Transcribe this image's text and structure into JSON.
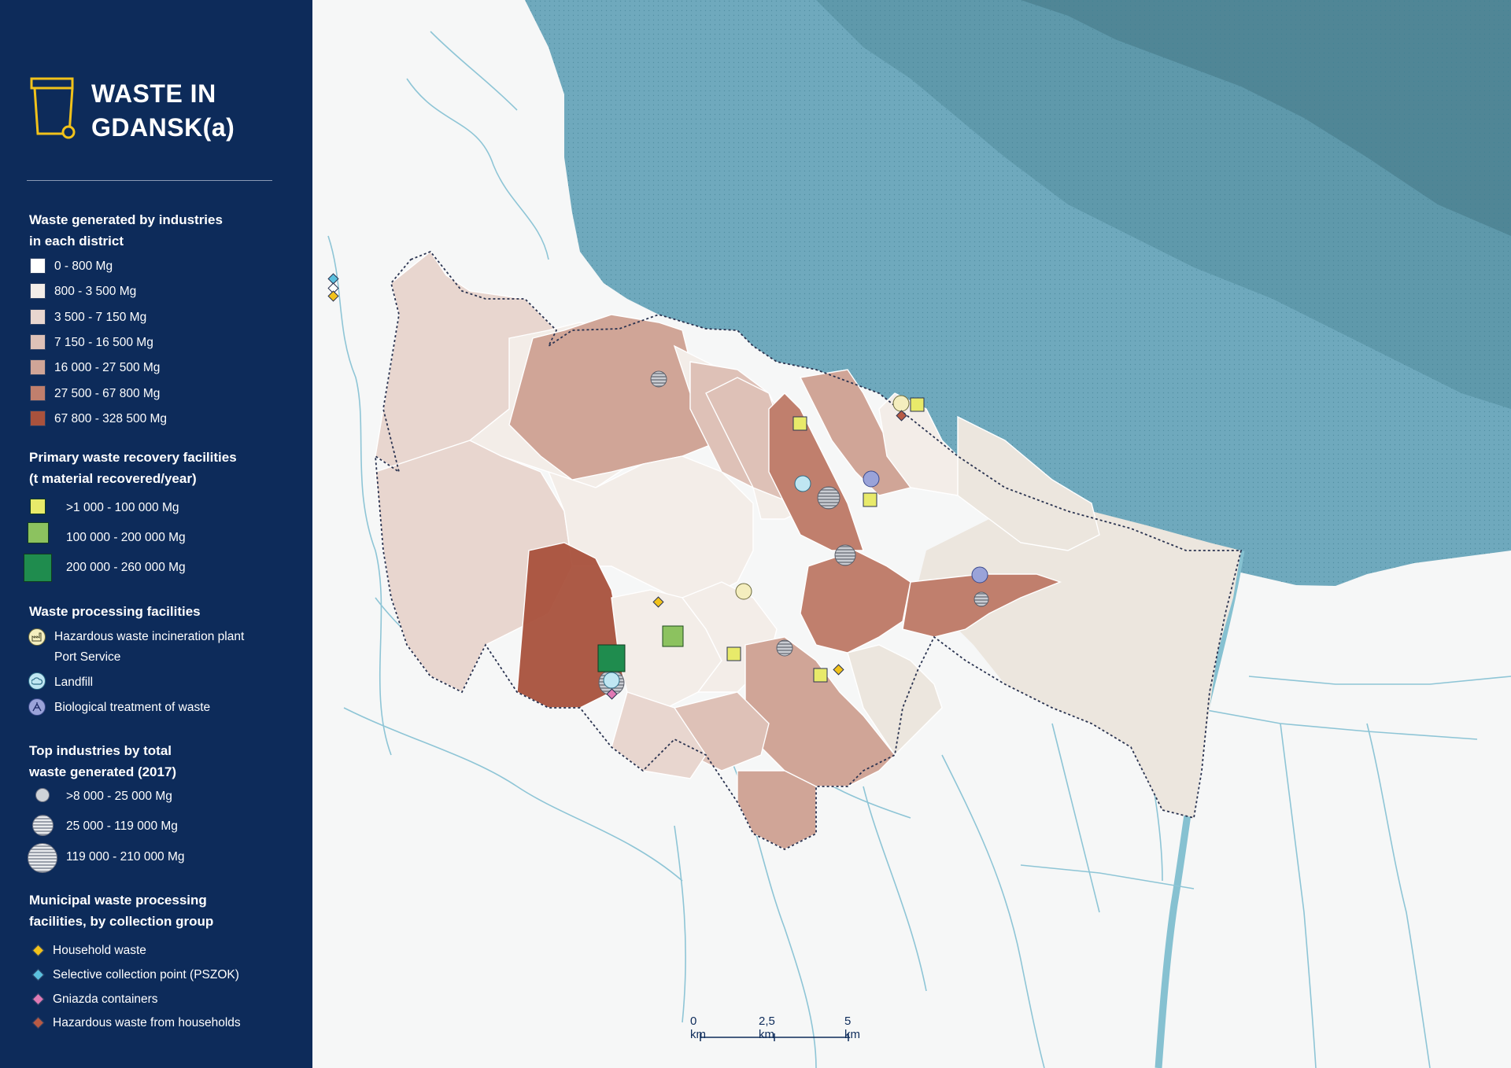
{
  "title": "WASTE IN GDANSK(a)",
  "colors": {
    "sidebar_bg": "#0d2b5a",
    "sea": "#5fa3b8",
    "sea_deep": "#4f7f8c",
    "land": "#f6f7f7",
    "rivers": "#8ec5d6",
    "boundary": "#2a3350"
  },
  "legend_industry": {
    "title_line1": "Waste generated by industries",
    "title_line2": "in each district",
    "classes": [
      {
        "label": "0 - 800 Mg",
        "color": "#ffffff"
      },
      {
        "label": "800 - 3 500 Mg",
        "color": "#f3ede8"
      },
      {
        "label": "3 500 - 7 150 Mg",
        "color": "#e8d6cf"
      },
      {
        "label": "7 150 - 16 500 Mg",
        "color": "#dec1b7"
      },
      {
        "label": "16 000 - 27 500 Mg",
        "color": "#d0a597"
      },
      {
        "label": "27 500 - 67 800 Mg",
        "color": "#c07f6d"
      },
      {
        "label": "67 800 - 328 500 Mg",
        "color": "#a9523d"
      }
    ]
  },
  "legend_recovery": {
    "title_line1": "Primary waste recovery facilities",
    "title_line2": "(t material recovered/year)",
    "classes": [
      {
        "label": ">1 000 - 100 000 Mg",
        "color": "#e8ea6a"
      },
      {
        "label": "100 000 - 200 000 Mg",
        "color": "#8cc25f"
      },
      {
        "label": "200 000 - 260 000 Mg",
        "color": "#1f8c4e"
      }
    ]
  },
  "legend_processing": {
    "title": "Waste processing facilities",
    "items": [
      {
        "label_line1": "Hazardous waste incineration plant",
        "label_line2": "Port Service",
        "icon": "factory-icon",
        "color": "#f4eebe"
      },
      {
        "label_line1": "Landfill",
        "label_line2": "",
        "icon": "cloud-icon",
        "color": "#bfe6f2"
      },
      {
        "label_line1": "Biological treatment of waste",
        "label_line2": "",
        "icon": "bio-icon",
        "color": "#9aa3d9"
      }
    ]
  },
  "legend_top": {
    "title_line1": "Top industries by total",
    "title_line2": "waste generated (2017)",
    "classes": [
      {
        "label": ">8 000 - 25 000 Mg"
      },
      {
        "label": "25 000 - 119 000 Mg"
      },
      {
        "label": "119 000 - 210 000 Mg"
      }
    ]
  },
  "legend_municipal": {
    "title_line1": "Municipal waste processing",
    "title_line2": "facilities, by collection group",
    "items": [
      {
        "label": "Household waste",
        "color": "#f1c21b"
      },
      {
        "label": "Selective collection point (PSZOK)",
        "color": "#5bc0de"
      },
      {
        "label": "Gniazda containers",
        "color": "#e07ab4"
      },
      {
        "label": "Hazardous waste from households",
        "color": "#b85a44"
      }
    ]
  },
  "scale": {
    "label_0": "0 km",
    "label_mid": "2,5 km",
    "label_end": "5 km"
  }
}
